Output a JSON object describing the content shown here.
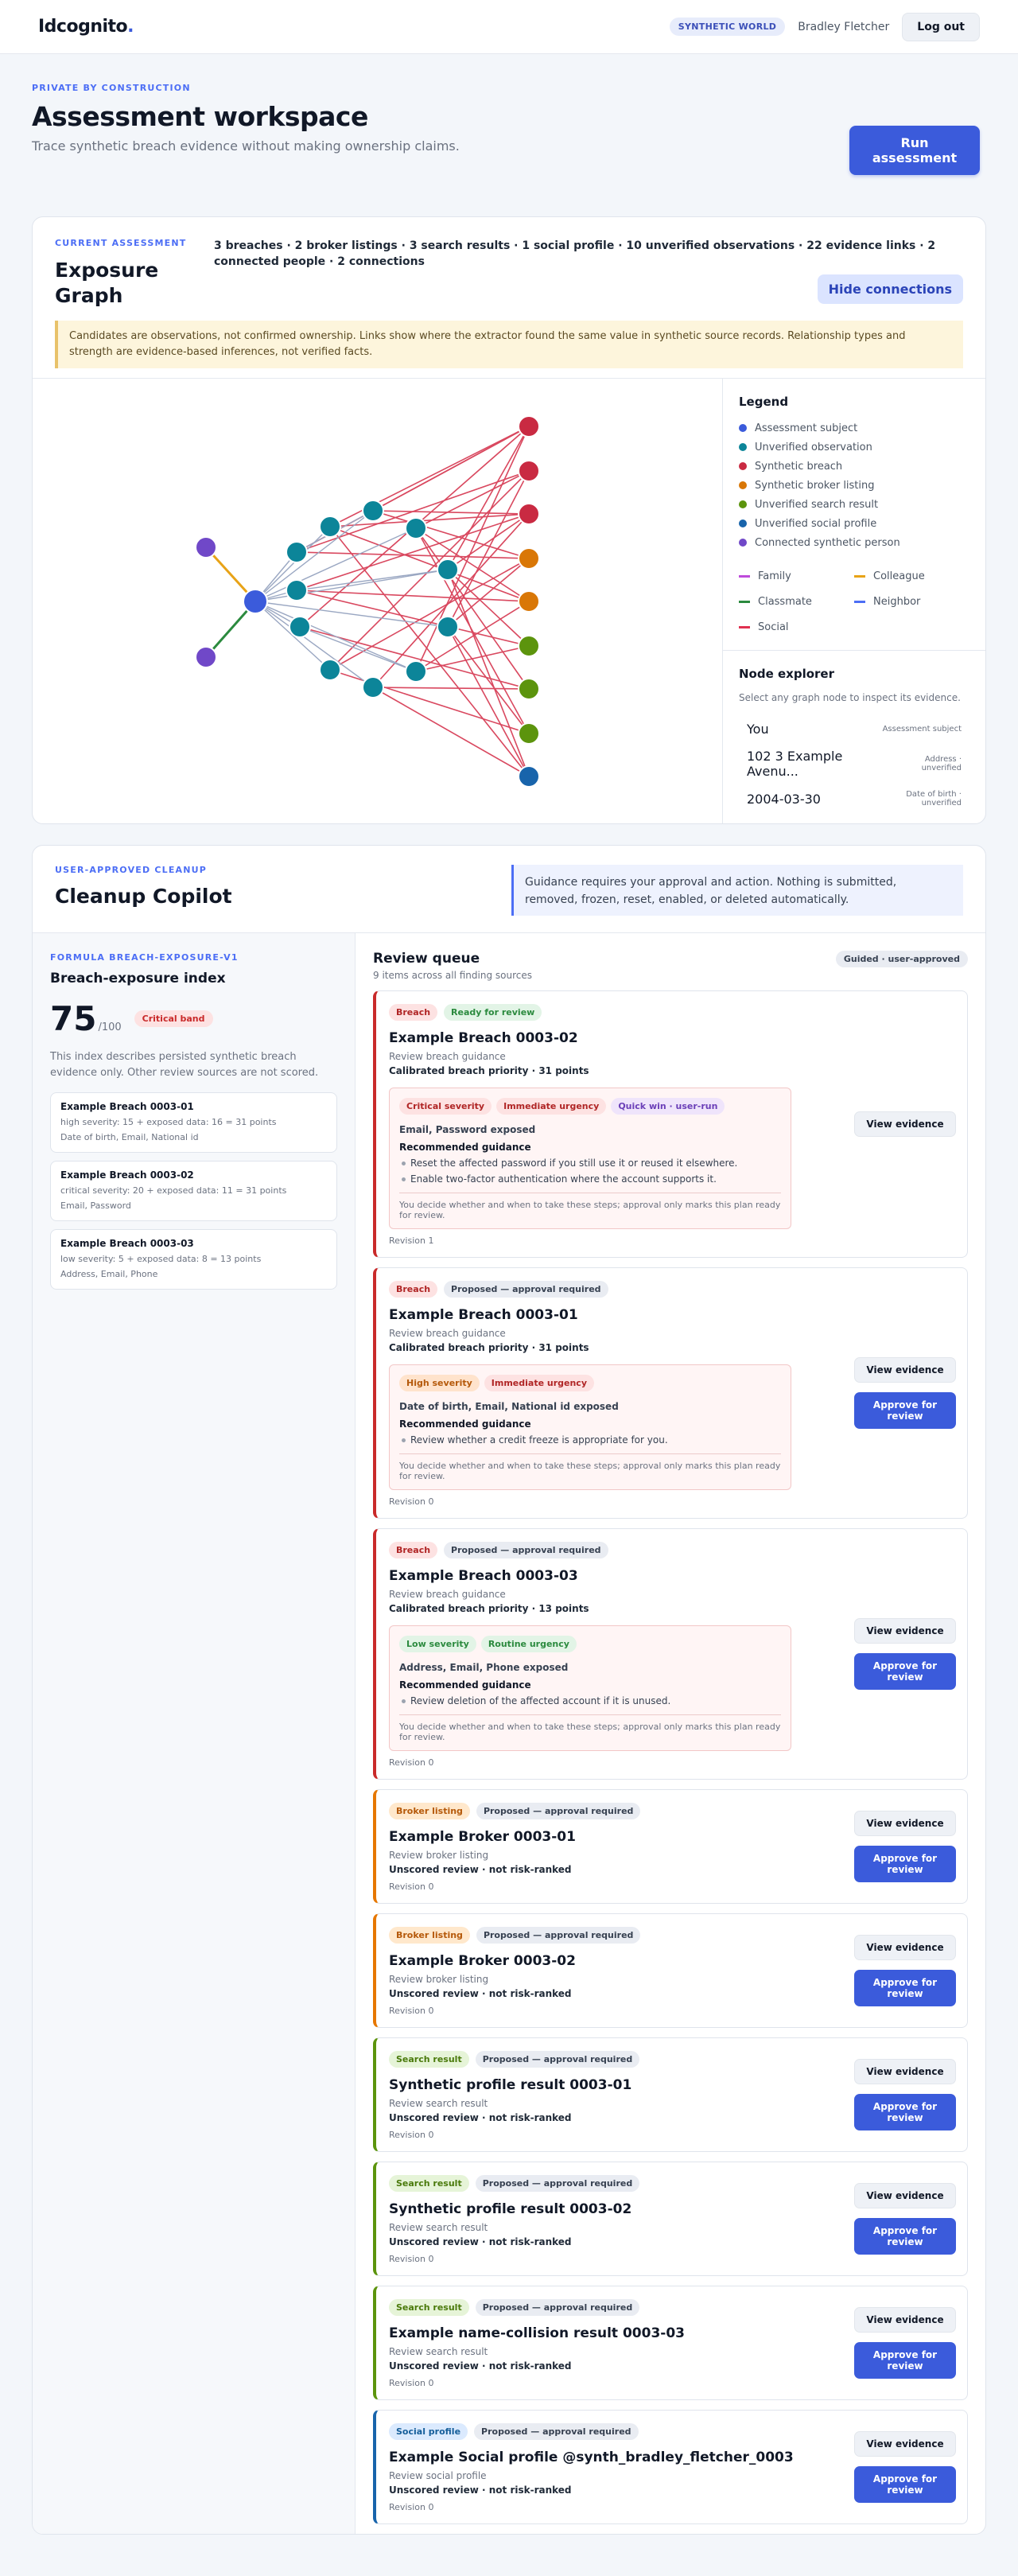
{
  "topbar": {
    "brand": "Idcognito",
    "world_badge": "SYNTHETIC WORLD",
    "user": "Bradley Fletcher",
    "logout": "Log out"
  },
  "hero": {
    "eyebrow": "PRIVATE BY CONSTRUCTION",
    "title": "Assessment workspace",
    "subtitle": "Trace synthetic breach evidence without making ownership claims.",
    "run_button": "Run assessment"
  },
  "assessment": {
    "eyebrow": "CURRENT ASSESSMENT",
    "title": "Exposure Graph",
    "stats": "3 breaches · 2 broker listings · 3 search results · 1 social profile · 10 unverified observations · 22 evidence links · 2 connected people · 2 connections",
    "hide_button": "Hide connections",
    "notice": "Candidates are observations, not confirmed ownership. Links show where the extractor found the same value in synthetic source records. Relationship types and strength are evidence-based inferences, not verified facts.",
    "colors": {
      "subject": "#3b5bdb",
      "observation": "#0c8599",
      "breach": "#c92a42",
      "broker": "#d97706",
      "search": "#5c940d",
      "social": "#1864ab",
      "person": "#7048c8"
    }
  },
  "legend": {
    "title": "Legend",
    "nodes": [
      {
        "label": "Assessment subject",
        "color": "#3b5bdb"
      },
      {
        "label": "Unverified observation",
        "color": "#0c8599"
      },
      {
        "label": "Synthetic breach",
        "color": "#c92a42"
      },
      {
        "label": "Synthetic broker listing",
        "color": "#d97706"
      },
      {
        "label": "Unverified search result",
        "color": "#5c940d"
      },
      {
        "label": "Unverified social profile",
        "color": "#1864ab"
      },
      {
        "label": "Connected synthetic person",
        "color": "#7048c8"
      }
    ],
    "relations": [
      {
        "label": "Family",
        "color": "#be4bdb"
      },
      {
        "label": "Colleague",
        "color": "#e8a317"
      },
      {
        "label": "Classmate",
        "color": "#2b8a3e"
      },
      {
        "label": "Neighbor",
        "color": "#4c6ef5"
      },
      {
        "label": "Social",
        "color": "#e03150"
      }
    ]
  },
  "explorer": {
    "title": "Node explorer",
    "subtitle": "Select any graph node to inspect its evidence.",
    "rows": [
      {
        "value": "You",
        "kind": "Assessment subject"
      },
      {
        "value": "102 3 Example Avenu...",
        "kind": "Address · unverified"
      },
      {
        "value": "2004-03-30",
        "kind": "Date of birth · unverified"
      }
    ]
  },
  "cleanup": {
    "eyebrow": "USER-APPROVED CLEANUP",
    "title": "Cleanup Copilot",
    "note": "Guidance requires your approval and action. Nothing is submitted, removed, frozen, reset, enabled, or deleted automatically."
  },
  "formula": {
    "eyebrow": "FORMULA BREACH-EXPOSURE-V1",
    "title": "Breach-exposure index",
    "score": "75",
    "denominator": "/100",
    "band": "Critical band",
    "description": "This index describes persisted synthetic breach evidence only. Other review sources are not scored.",
    "items": [
      {
        "name": "Example Breach 0003-01",
        "calc": "high severity: 15 + exposed data: 16 = 31 points",
        "data": "Date of birth, Email, National id"
      },
      {
        "name": "Example Breach 0003-02",
        "calc": "critical severity: 20 + exposed data: 11 = 31 points",
        "data": "Email, Password"
      },
      {
        "name": "Example Breach 0003-03",
        "calc": "low severity: 5 + exposed data: 8 = 13 points",
        "data": "Address, Email, Phone"
      }
    ]
  },
  "queue": {
    "title": "Review queue",
    "subtitle": "9 items across all finding sources",
    "badge": "Guided · user-approved",
    "view_label": "View evidence",
    "approve_label": "Approve for review",
    "footer": "You decide whether and when to take these steps; approval only marks this plan ready for review.",
    "rec_heading": "Recommended guidance",
    "items": [
      {
        "kind": "Breach",
        "status": "Ready for review",
        "name": "Example Breach 0003-02",
        "category": "Review breach guidance",
        "priority": "Calibrated breach priority · 31 points",
        "revision": "Revision 1",
        "severity": "Critical severity",
        "urgency": "Immediate urgency",
        "quick": "Quick win · user-run",
        "exposed": "Email, Password exposed",
        "steps": [
          "Reset the affected password if you still use it or reused it elsewhere.",
          "Enable two-factor authentication where the account supports it."
        ]
      },
      {
        "kind": "Breach",
        "status": "Proposed — approval required",
        "name": "Example Breach 0003-01",
        "category": "Review breach guidance",
        "priority": "Calibrated breach priority · 31 points",
        "revision": "Revision 0",
        "severity": "High severity",
        "urgency": "Immediate urgency",
        "exposed": "Date of birth, Email, National id exposed",
        "steps": [
          "Review whether a credit freeze is appropriate for you."
        ]
      },
      {
        "kind": "Breach",
        "status": "Proposed — approval required",
        "name": "Example Breach 0003-03",
        "category": "Review breach guidance",
        "priority": "Calibrated breach priority · 13 points",
        "revision": "Revision 0",
        "severity": "Low severity",
        "urgency": "Routine urgency",
        "exposed": "Address, Email, Phone exposed",
        "steps": [
          "Review deletion of the affected account if it is unused."
        ]
      },
      {
        "kind": "Broker listing",
        "status": "Proposed — approval required",
        "name": "Example Broker 0003-01",
        "category": "Review broker listing",
        "priority": "Unscored review · not risk-ranked",
        "revision": "Revision 0"
      },
      {
        "kind": "Broker listing",
        "status": "Proposed — approval required",
        "name": "Example Broker 0003-02",
        "category": "Review broker listing",
        "priority": "Unscored review · not risk-ranked",
        "revision": "Revision 0"
      },
      {
        "kind": "Search result",
        "status": "Proposed — approval required",
        "name": "Synthetic profile result 0003-01",
        "category": "Review search result",
        "priority": "Unscored review · not risk-ranked",
        "revision": "Revision 0"
      },
      {
        "kind": "Search result",
        "status": "Proposed — approval required",
        "name": "Synthetic profile result 0003-02",
        "category": "Review search result",
        "priority": "Unscored review · not risk-ranked",
        "revision": "Revision 0"
      },
      {
        "kind": "Search result",
        "status": "Proposed — approval required",
        "name": "Example name-collision result 0003-03",
        "category": "Review search result",
        "priority": "Unscored review · not risk-ranked",
        "revision": "Revision 0"
      },
      {
        "kind": "Social profile",
        "status": "Proposed — approval required",
        "name": "Example Social profile @synth_bradley_fletcher_0003",
        "category": "Review social profile",
        "priority": "Unscored review · not risk-ranked",
        "revision": "Revision 0"
      }
    ]
  }
}
